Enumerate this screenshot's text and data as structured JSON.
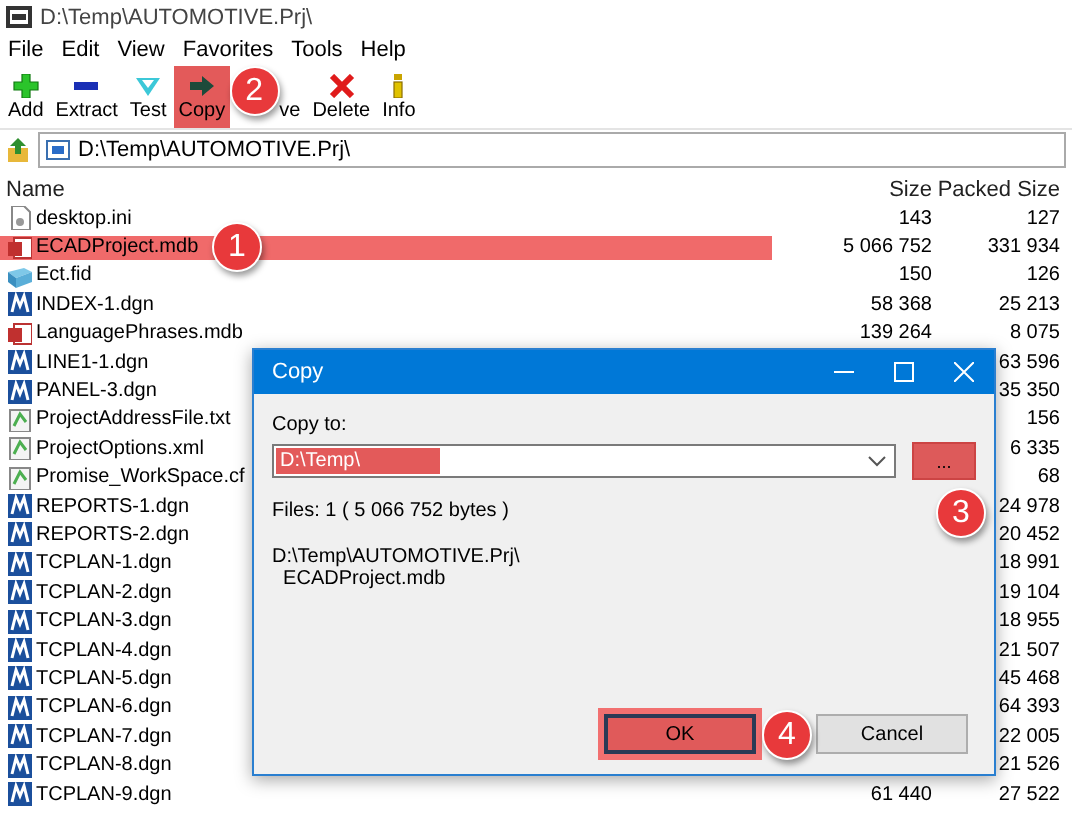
{
  "window": {
    "title": "D:\\Temp\\AUTOMOTIVE.Prj\\"
  },
  "menu": [
    "File",
    "Edit",
    "View",
    "Favorites",
    "Tools",
    "Help"
  ],
  "toolbar": [
    {
      "kind": "add",
      "label": "Add",
      "highlighted": false
    },
    {
      "kind": "extract",
      "label": "Extract",
      "highlighted": false
    },
    {
      "kind": "test",
      "label": "Test",
      "highlighted": false
    },
    {
      "kind": "copy",
      "label": "Copy",
      "highlighted": true
    },
    {
      "kind": "move",
      "label": "ve",
      "highlighted": false
    },
    {
      "kind": "delete",
      "label": "Delete",
      "highlighted": false
    },
    {
      "kind": "info",
      "label": "Info",
      "highlighted": false
    }
  ],
  "address": "D:\\Temp\\AUTOMOTIVE.Prj\\",
  "columns": [
    "Name",
    "Size",
    "Packed Size"
  ],
  "rows": [
    {
      "kind": "ini",
      "name": "desktop.ini",
      "size": "143",
      "packed_size": "127",
      "highlighted": false
    },
    {
      "kind": "mdb",
      "name": "ECADProject.mdb",
      "size": "5 066 752",
      "packed_size": "331 934",
      "highlighted": true
    },
    {
      "kind": "fid",
      "name": "Ect.fid",
      "size": "150",
      "packed_size": "126",
      "highlighted": false
    },
    {
      "kind": "dgn",
      "name": "INDEX-1.dgn",
      "size": "58 368",
      "packed_size": "25 213",
      "highlighted": false
    },
    {
      "kind": "mdb",
      "name": "LanguagePhrases.mdb",
      "size": "139 264",
      "packed_size": "8 075",
      "highlighted": false
    },
    {
      "kind": "dgn",
      "name": "LINE1-1.dgn",
      "packed_size": "63 596",
      "highlighted": false
    },
    {
      "kind": "dgn",
      "name": "PANEL-3.dgn",
      "packed_size": "35 350",
      "highlighted": false
    },
    {
      "kind": "txt",
      "name": "ProjectAddressFile.txt",
      "packed_size": "156",
      "highlighted": false
    },
    {
      "kind": "txt",
      "name": "ProjectOptions.xml",
      "packed_size": "6 335",
      "highlighted": false
    },
    {
      "kind": "txt",
      "name": "Promise_WorkSpace.cf",
      "packed_size": "68",
      "highlighted": false
    },
    {
      "kind": "dgn",
      "name": "REPORTS-1.dgn",
      "packed_size": "24 978",
      "highlighted": false
    },
    {
      "kind": "dgn",
      "name": "REPORTS-2.dgn",
      "packed_size": "20 452",
      "highlighted": false
    },
    {
      "kind": "dgn",
      "name": "TCPLAN-1.dgn",
      "packed_size": "18 991",
      "highlighted": false
    },
    {
      "kind": "dgn",
      "name": "TCPLAN-2.dgn",
      "packed_size": "19 104",
      "highlighted": false
    },
    {
      "kind": "dgn",
      "name": "TCPLAN-3.dgn",
      "packed_size": "18 955",
      "highlighted": false
    },
    {
      "kind": "dgn",
      "name": "TCPLAN-4.dgn",
      "packed_size": "21 507",
      "highlighted": false
    },
    {
      "kind": "dgn",
      "name": "TCPLAN-5.dgn",
      "packed_size": "45 468",
      "highlighted": false
    },
    {
      "kind": "dgn",
      "name": "TCPLAN-6.dgn",
      "packed_size": "64 393",
      "highlighted": false
    },
    {
      "kind": "dgn",
      "name": "TCPLAN-7.dgn",
      "packed_size": "22 005",
      "highlighted": false
    },
    {
      "kind": "dgn",
      "name": "TCPLAN-8.dgn",
      "packed_size": "21 526",
      "highlighted": false
    },
    {
      "kind": "dgn",
      "name": "TCPLAN-9.dgn",
      "size": "61 440",
      "packed_size": "27 522",
      "highlighted": false
    }
  ],
  "dialog": {
    "title": "Copy",
    "copy_to_label": "Copy to:",
    "path": {
      "value": "D:\\Temp\\",
      "highlighted": true
    },
    "browse": {
      "label": "...",
      "highlighted": true
    },
    "files_info": "Files: 1   ( 5 066 752 bytes )",
    "source_lines": [
      "D:\\Temp\\AUTOMOTIVE.Prj\\",
      "  ECADProject.mdb"
    ],
    "buttons": [
      {
        "label": "OK",
        "highlighted": true
      },
      {
        "label": "Cancel",
        "highlighted": false
      }
    ]
  },
  "callouts": [
    "1",
    "2",
    "3",
    "4"
  ]
}
